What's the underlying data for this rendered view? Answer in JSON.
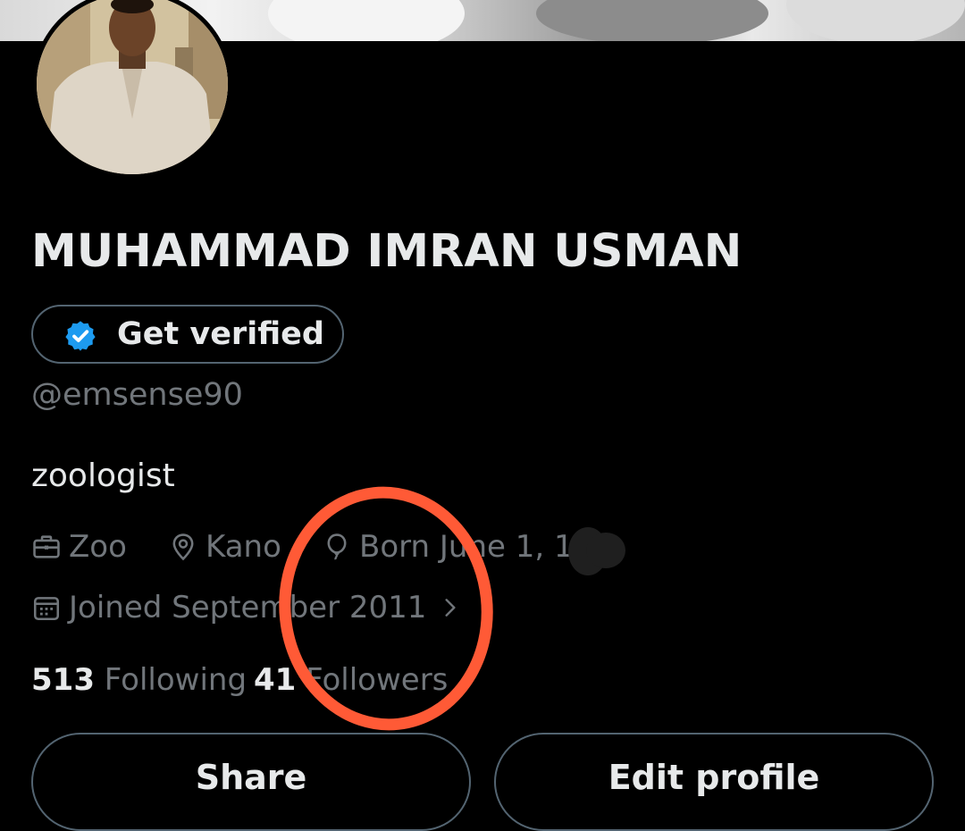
{
  "profile": {
    "display_name": "MUHAMMAD IMRAN USMAN",
    "verify_label": "Get verified",
    "handle": "@emsense90",
    "bio": "zoologist"
  },
  "meta": {
    "work": "Zoo",
    "location": "Kano",
    "birthday": "Born June 1, 19",
    "joined": "Joined September 2011"
  },
  "stats": {
    "following_count": "513",
    "following_label": "Following",
    "followers_count": "41",
    "followers_label": "Followers"
  },
  "actions": {
    "share_label": "Share",
    "edit_label": "Edit profile"
  },
  "icons": {
    "verified": "verified-badge-icon",
    "work": "briefcase-icon",
    "location": "location-pin-icon",
    "birthday": "balloon-icon",
    "joined": "calendar-icon",
    "joined_chevron": "chevron-right-icon"
  },
  "colors": {
    "background": "#000000",
    "text_primary": "#e7e9ea",
    "text_secondary": "#71767b",
    "border": "#536471",
    "verified_blue": "#1d9bf0",
    "annotation_red": "#ff5a36"
  }
}
